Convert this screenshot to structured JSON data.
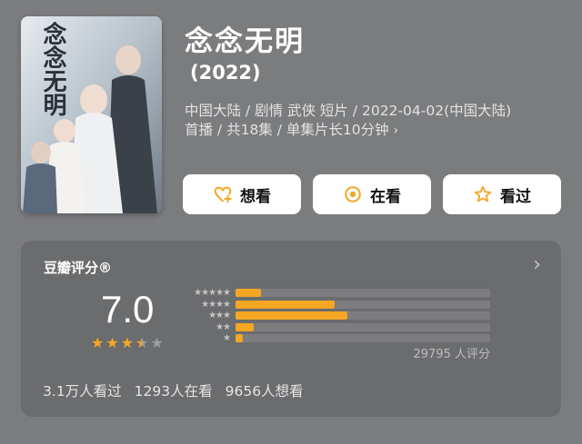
{
  "movie": {
    "title": "念念无明",
    "year": "(2022)",
    "meta_line1": "中国大陆 / 剧情 武侠 短片 / 2022-04-02(中国大陆)",
    "meta_line2": "首播 / 共18集 / 单集片长10分钟",
    "meta_chevron": "›",
    "poster_title": "念念无明"
  },
  "actions": {
    "want_label": "想看",
    "watching_label": "在看",
    "watched_label": "看过"
  },
  "rating": {
    "panel_title": "豆瓣评分®",
    "score": "7.0",
    "stars_value": 3.5,
    "stars_max": 5,
    "distribution_fraction": [
      0.1,
      0.39,
      0.44,
      0.07,
      0.03
    ],
    "distribution_labels": [
      "★★★★★",
      "★★★★",
      "★★★",
      "★★",
      "★"
    ],
    "count_text": "29795 人评分",
    "arrow": "›"
  },
  "stats": {
    "watched": "3.1万人看过",
    "watching": "1293人在看",
    "want": "9656人想看"
  },
  "colors": {
    "accent": "#f5a623",
    "background": "#7b7c7e",
    "panel": "#6b6c6e"
  }
}
